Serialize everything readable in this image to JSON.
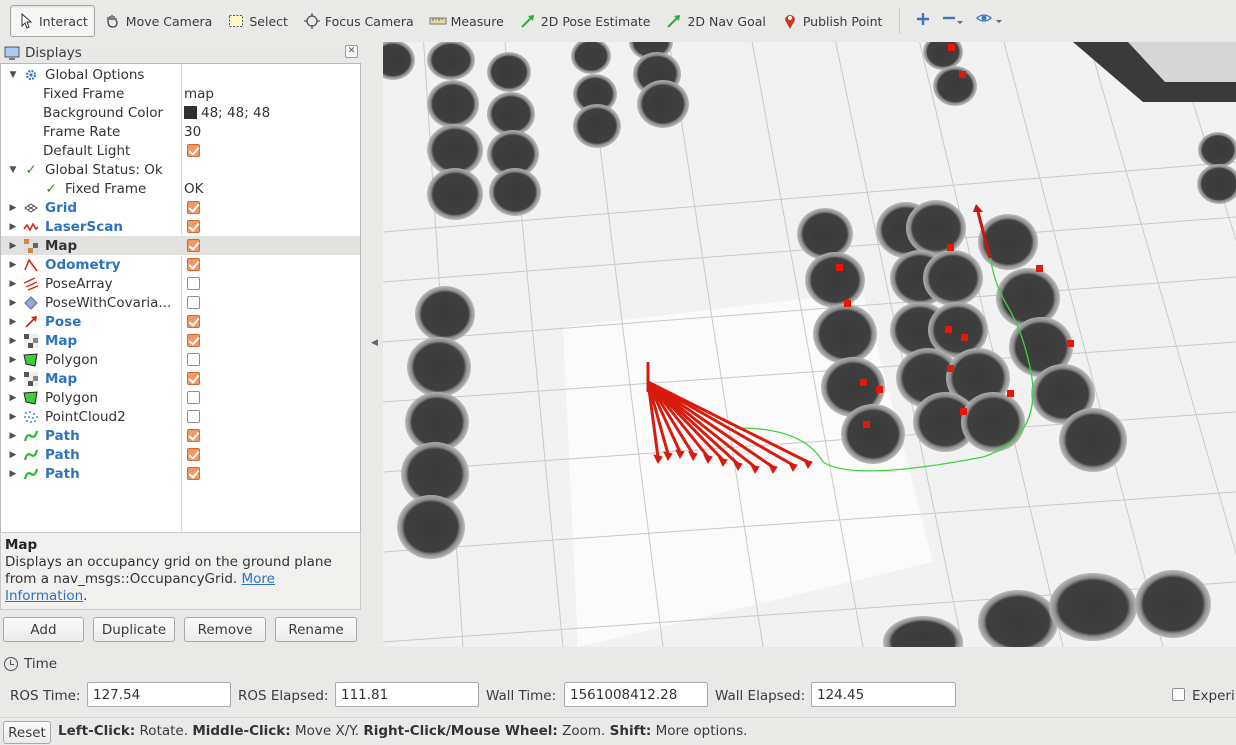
{
  "toolbar": {
    "tools": [
      {
        "label": "Interact",
        "icon": "cursor-icon"
      },
      {
        "label": "Move Camera",
        "icon": "move-camera-icon"
      },
      {
        "label": "Select",
        "icon": "select-box-icon"
      },
      {
        "label": "Focus Camera",
        "icon": "focus-crosshair-icon"
      },
      {
        "label": "Measure",
        "icon": "ruler-icon"
      },
      {
        "label": "2D Pose Estimate",
        "icon": "green-arrow-icon"
      },
      {
        "label": "2D Nav Goal",
        "icon": "green-arrow-icon"
      },
      {
        "label": "Publish Point",
        "icon": "map-pin-icon"
      }
    ]
  },
  "displays": {
    "title": "Displays",
    "global_options": {
      "label": "Global Options",
      "fixed_frame_label": "Fixed Frame",
      "fixed_frame_value": "map",
      "background_color_label": "Background Color",
      "background_color_value": "48; 48; 48",
      "frame_rate_label": "Frame Rate",
      "frame_rate_value": "30",
      "default_light_label": "Default Light"
    },
    "global_status": {
      "label": "Global Status: Ok",
      "fixed_frame_label": "Fixed Frame",
      "fixed_frame_value": "OK"
    },
    "items": [
      {
        "label": "Grid",
        "checked": true,
        "style": "blue"
      },
      {
        "label": "LaserScan",
        "checked": true,
        "style": "blue"
      },
      {
        "label": "Map",
        "checked": true,
        "style": "bold",
        "selected": true
      },
      {
        "label": "Odometry",
        "checked": true,
        "style": "blue"
      },
      {
        "label": "PoseArray",
        "checked": false,
        "style": "normal"
      },
      {
        "label": "PoseWithCovaria...",
        "checked": false,
        "style": "normal"
      },
      {
        "label": "Pose",
        "checked": true,
        "style": "blue"
      },
      {
        "label": "Map",
        "checked": true,
        "style": "blue"
      },
      {
        "label": "Polygon",
        "checked": false,
        "style": "normal"
      },
      {
        "label": "Map",
        "checked": true,
        "style": "blue"
      },
      {
        "label": "Polygon",
        "checked": false,
        "style": "normal"
      },
      {
        "label": "PointCloud2",
        "checked": false,
        "style": "normal"
      },
      {
        "label": "Path",
        "checked": true,
        "style": "blue"
      },
      {
        "label": "Path",
        "checked": true,
        "style": "blue"
      },
      {
        "label": "Path",
        "checked": true,
        "style": "blue"
      }
    ],
    "description": {
      "title": "Map",
      "text": "Displays an occupancy grid on the ground plane from a nav_msgs::OccupancyGrid.",
      "link": "More Information",
      "link_a": "More",
      "link_b": "Information",
      "period": "."
    },
    "buttons": {
      "add": "Add",
      "duplicate": "Duplicate",
      "remove": "Remove",
      "rename": "Rename"
    }
  },
  "time": {
    "title": "Time",
    "ros_time_label": "ROS Time:",
    "ros_time": "127.54",
    "ros_elapsed_label": "ROS Elapsed:",
    "ros_elapsed": "111.81",
    "wall_time_label": "Wall Time:",
    "wall_time": "1561008412.28",
    "wall_elapsed_label": "Wall Elapsed:",
    "wall_elapsed": "124.45",
    "experimental_label": "Experi"
  },
  "status": {
    "reset": "Reset",
    "left_click": "Left-Click:",
    "left_click_text": "Rotate.",
    "middle_click": "Middle-Click:",
    "middle_click_text": "Move X/Y.",
    "right_click": "Right-Click/Mouse Wheel:",
    "right_click_text": "Zoom.",
    "shift": "Shift:",
    "shift_text": "More options."
  },
  "colors": {
    "accent_blue": "#2f73be",
    "checkbox_on": "#f09866",
    "obstacle": "#3a3a3a",
    "inflation": "#8c8c8c",
    "path": "#3fd23f",
    "pose_arrow": "#d81b0f"
  }
}
